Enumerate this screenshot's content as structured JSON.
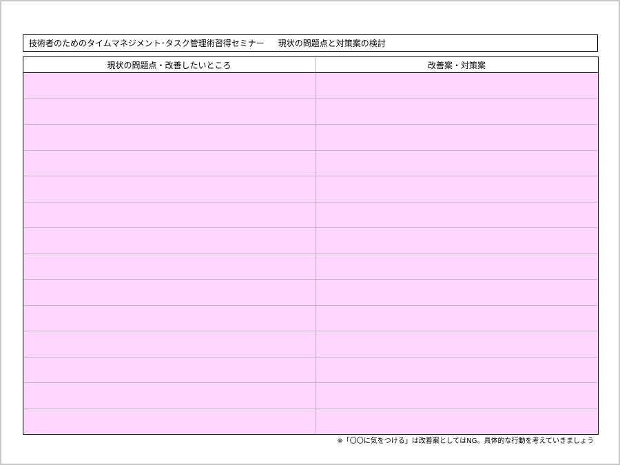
{
  "header": {
    "seminar_title": "技術者のためのタイムマネジメント･タスク管理術習得セミナー",
    "sheet_title": "現状の問題点と対策案の検討"
  },
  "table": {
    "columns": [
      {
        "label": "現状の問題点・改善したいところ"
      },
      {
        "label": "改善案・対策案"
      }
    ],
    "row_count": 14
  },
  "footnote": "※「〇〇に気をつける」は改善案としてはNG。具体的な行動を考えていきましょう",
  "colors": {
    "row_fill": "#ffd6ff",
    "row_divider": "#c5b3c5",
    "border": "#000000"
  }
}
